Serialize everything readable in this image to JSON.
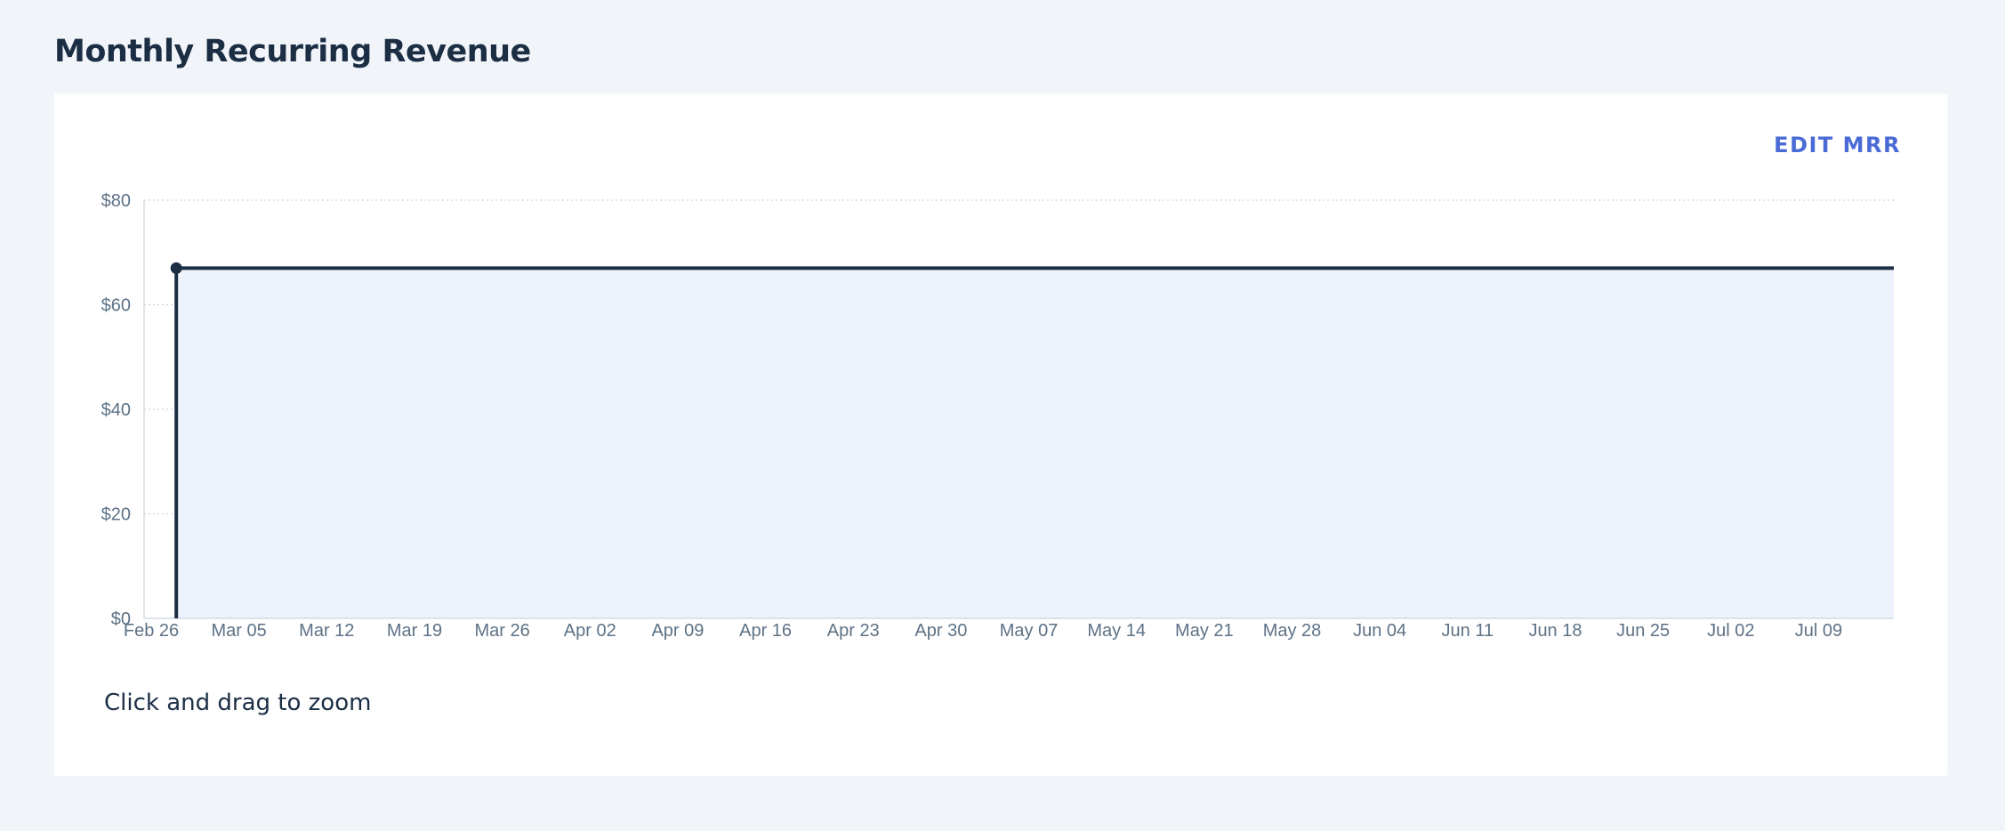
{
  "header": {
    "title": "Monthly Recurring Revenue"
  },
  "card": {
    "edit_label": "EDIT MRR",
    "hint": "Click and drag to zoom"
  },
  "colors": {
    "line": "#1b2e44",
    "area_fill": "#eef2fc",
    "grid": "#c9d3de",
    "accent": "#4a6bd6",
    "background": "#f1f4f9"
  },
  "chart_data": {
    "type": "area",
    "title": "",
    "xlabel": "",
    "ylabel": "",
    "ylim": [
      0,
      80
    ],
    "yticks": [
      "$0",
      "$20",
      "$40",
      "$60",
      "$80"
    ],
    "ytick_values": [
      0,
      20,
      40,
      60,
      80
    ],
    "xticks": [
      "Feb 26",
      "Mar 05",
      "Mar 12",
      "Mar 19",
      "Mar 26",
      "Apr 02",
      "Apr 09",
      "Apr 16",
      "Apr 23",
      "Apr 30",
      "May 07",
      "May 14",
      "May 21",
      "May 28",
      "Jun 04",
      "Jun 11",
      "Jun 18",
      "Jun 25",
      "Jul 02",
      "Jul 09"
    ],
    "xlim": [
      "Feb 26",
      "Jul 15"
    ],
    "grid": true,
    "series": [
      {
        "x": [
          "Feb 28",
          "Jul 15"
        ],
        "values": [
          67,
          67
        ]
      }
    ]
  }
}
